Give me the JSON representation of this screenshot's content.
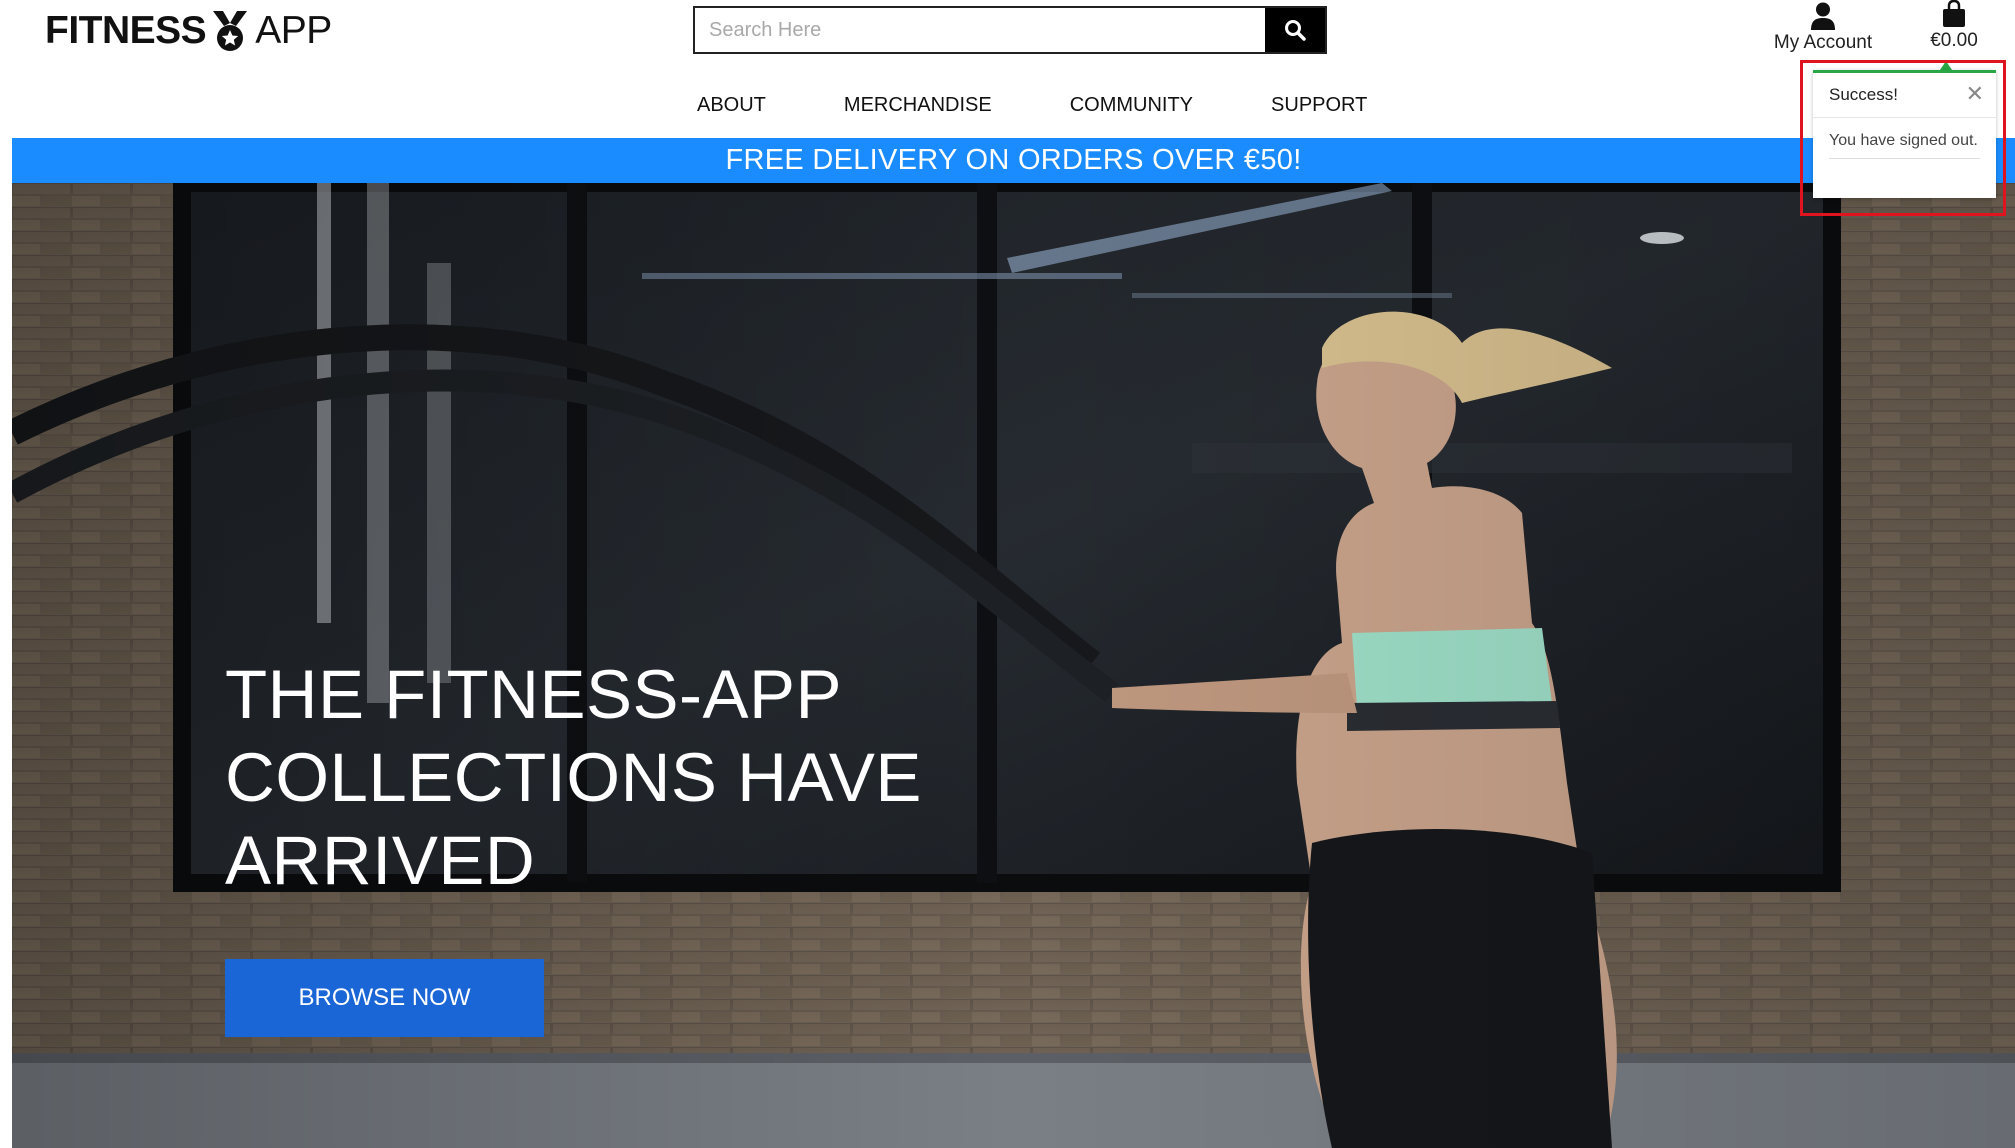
{
  "header": {
    "logo": {
      "word1": "FITNESS",
      "word2": "APP",
      "icon": "medal-icon"
    },
    "search": {
      "placeholder": "Search Here",
      "value": "",
      "button_icon": "search-icon"
    },
    "account": {
      "label": "My Account",
      "icon": "user-icon"
    },
    "bag": {
      "total": "€0.00",
      "icon": "shopping-bag-icon"
    }
  },
  "nav": {
    "items": [
      {
        "label": "ABOUT"
      },
      {
        "label": "MERCHANDISE"
      },
      {
        "label": "COMMUNITY"
      },
      {
        "label": "SUPPORT"
      }
    ]
  },
  "banner": {
    "text": "FREE DELIVERY ON ORDERS OVER €50!",
    "color": "#1a8cff"
  },
  "hero": {
    "title": "THE FITNESS-APP\nCOLLECTIONS HAVE\nARRIVED",
    "button_label": "BROWSE NOW",
    "button_color": "#1a66d6",
    "image": "woman-battle-ropes-gym-photo"
  },
  "toast": {
    "title": "Success!",
    "message": "You have signed out.",
    "close_icon": "close-icon",
    "accent_color": "#28a745",
    "highlight_color": "#e0141e"
  }
}
